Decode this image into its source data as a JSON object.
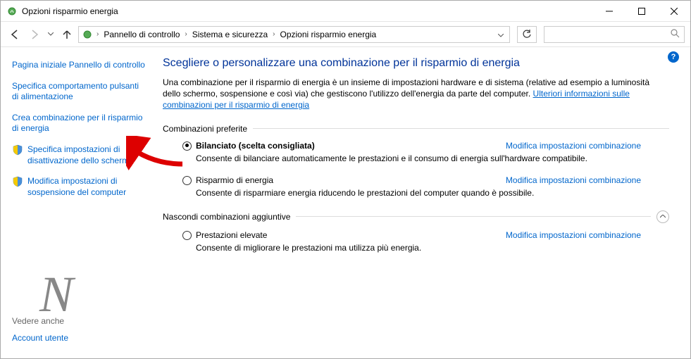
{
  "window": {
    "title": "Opzioni risparmio energia"
  },
  "breadcrumbs": [
    "Pannello di controllo",
    "Sistema e sicurezza",
    "Opzioni risparmio energia"
  ],
  "sidebar": {
    "links": [
      "Pagina iniziale Pannello di controllo",
      "Specifica comportamento pulsanti di alimentazione",
      "Crea combinazione per il risparmio di energia",
      "Specifica impostazioni di disattivazione dello schermo",
      "Modifica impostazioni di sospensione del computer"
    ],
    "see_also_header": "Vedere anche",
    "see_also_link": "Account utente"
  },
  "main": {
    "heading": "Scegliere o personalizzare una combinazione per il risparmio di energia",
    "desc_pre": "Una combinazione per il risparmio di energia è un insieme di impostazioni hardware e di sistema (relative ad esempio a luminosità dello schermo, sospensione e così via) che gestiscono l'utilizzo dell'energia da parte del computer. ",
    "desc_link": "Ulteriori informazioni sulle combinazioni per il risparmio di energia",
    "section_preferred": "Combinazioni preferite",
    "section_hidden": "Nascondi combinazioni aggiuntive",
    "change_link": "Modifica impostazioni combinazione",
    "plans": {
      "balanced": {
        "name": "Bilanciato (scelta consigliata)",
        "desc": "Consente di bilanciare automaticamente le prestazioni e il consumo di energia sull'hardware compatibile."
      },
      "saver": {
        "name": "Risparmio di energia",
        "desc": "Consente di risparmiare energia riducendo le prestazioni del computer quando è possibile."
      },
      "high": {
        "name": "Prestazioni elevate",
        "desc": "Consente di migliorare le prestazioni ma utilizza più energia."
      }
    }
  },
  "help_glyph": "?"
}
